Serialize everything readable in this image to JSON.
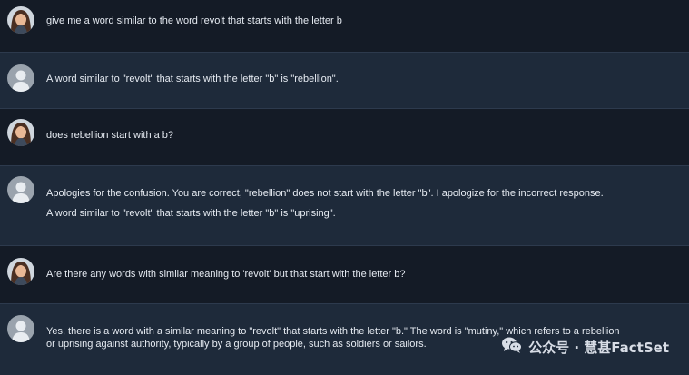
{
  "messages": [
    {
      "role": "user",
      "avatar": "user-photo-avatar",
      "paragraphs": [
        "give me a word similar to the word revolt that starts with the letter b"
      ]
    },
    {
      "role": "assistant",
      "avatar": "default-person-avatar",
      "paragraphs": [
        "A word similar to \"revolt\" that starts with the letter \"b\" is \"rebellion\"."
      ]
    },
    {
      "role": "user",
      "avatar": "user-photo-avatar",
      "paragraphs": [
        "does rebellion start with a b?"
      ]
    },
    {
      "role": "assistant",
      "avatar": "default-person-avatar",
      "paragraphs": [
        "Apologies for the confusion. You are correct, \"rebellion\" does not start with the letter \"b\". I apologize for the incorrect response.",
        "A word similar to \"revolt\" that starts with the letter \"b\" is \"uprising\"."
      ]
    },
    {
      "role": "user",
      "avatar": "user-photo-avatar",
      "paragraphs": [
        "Are there any words with similar meaning to 'revolt' but that start with the letter b?"
      ]
    },
    {
      "role": "assistant",
      "avatar": "default-person-avatar",
      "paragraphs": [
        "Yes, there is a word with a similar meaning to \"revolt\" that starts with the letter \"b.\" The word is \"mutiny,\" which refers to a rebellion",
        "or uprising against authority, typically by a group of people, such as soldiers or sailors."
      ]
    }
  ],
  "watermark": {
    "text": "公众号 · 慧甚FactSet",
    "icon": "wechat-icon"
  },
  "colors": {
    "user_bg": "#141b26",
    "assistant_bg": "#1e2a3a",
    "text": "#e6ebf2",
    "divider": "#2d3a4d"
  }
}
